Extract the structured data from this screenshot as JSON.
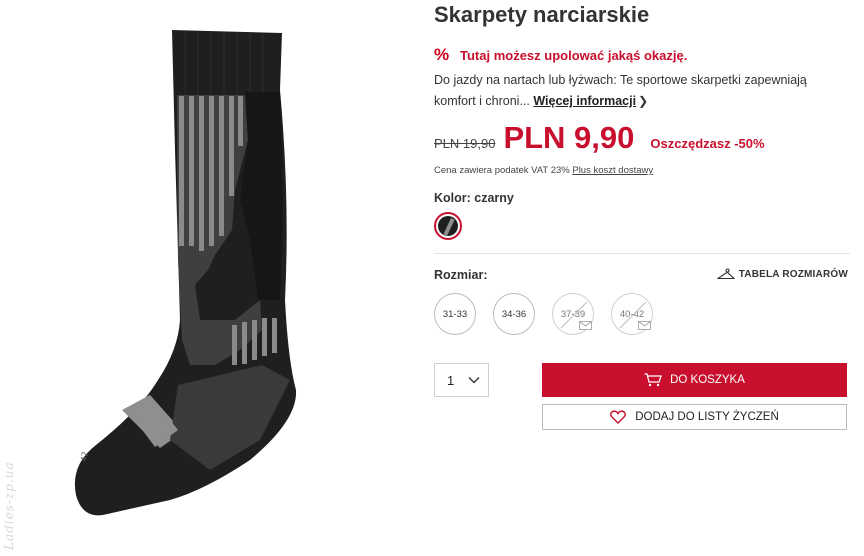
{
  "product": {
    "title": "Skarpety narciarskie",
    "promo_text": "Tutaj możesz upolować jakąś okazję.",
    "description": "Do jazdy na nartach lub łyżwach: Te sportowe skarpetki zapewniają komfort i chroni...",
    "more_info_label": "Więcej informacji",
    "watermark": "Ladies-zp.ua",
    "sock_tag": "42"
  },
  "price": {
    "old": "PLN 19,90",
    "new": "PLN 9,90",
    "saving": "Oszczędzasz -50%",
    "vat_note": "Cena zawiera podatek VAT 23%",
    "shipping_link": "Plus koszt dostawy"
  },
  "color": {
    "label": "Kolor: czarny",
    "selected_swatch": "#1f1f1f",
    "accent": "#c8102e"
  },
  "size": {
    "label": "Rozmiar:",
    "table_link": "TABELA ROZMIARÓW",
    "options": [
      {
        "label": "31-33",
        "available": true
      },
      {
        "label": "34-36",
        "available": true
      },
      {
        "label": "37-39",
        "available": false
      },
      {
        "label": "40-42",
        "available": false
      }
    ]
  },
  "quantity": {
    "value": "1"
  },
  "actions": {
    "add_to_cart": "DO KOSZYKA",
    "add_to_wishlist": "DODAJ DO LISTY ŻYCZEŃ"
  },
  "icons": {
    "promo": "percent-icon",
    "size_table": "hanger-icon",
    "cart": "cart-icon",
    "wishlist": "heart-icon",
    "unavailable_notify": "mail-icon"
  }
}
